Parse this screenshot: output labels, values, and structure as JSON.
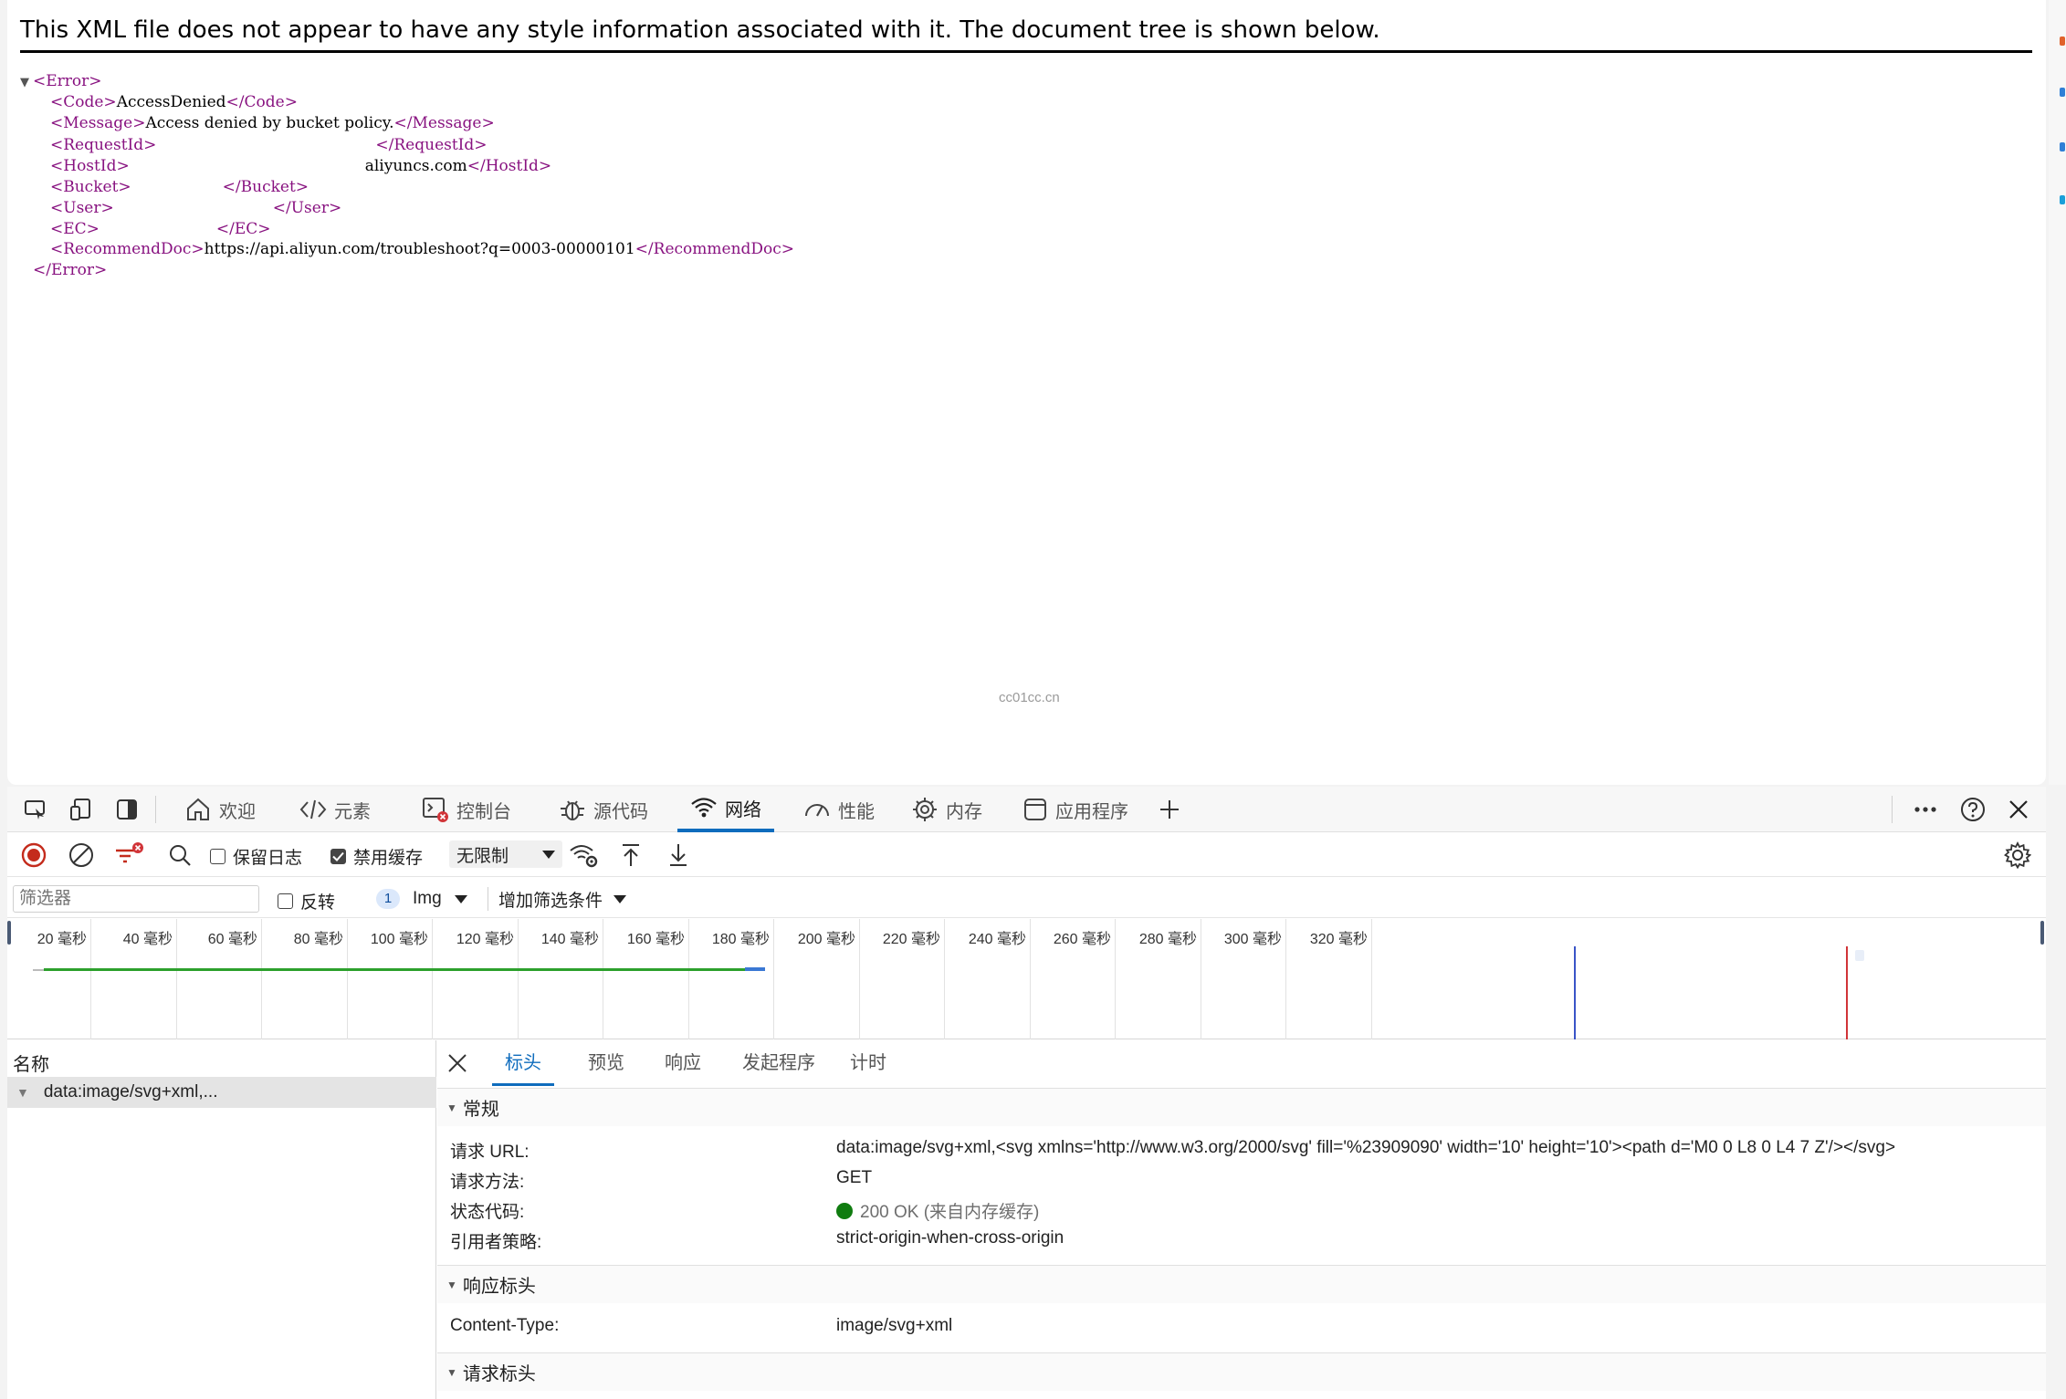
{
  "xml_viewer": {
    "banner": "This XML file does not appear to have any style information associated with it. The document tree is shown below.",
    "tree": {
      "root_open": "<Error>",
      "root_close": "</Error>",
      "code_open": "<Code>",
      "code_value": "AccessDenied",
      "code_close": "</Code>",
      "message_open": "<Message>",
      "message_value": "Access denied by bucket policy.",
      "message_close": "</Message>",
      "requestid_open": "<RequestId>",
      "requestid_close": "</RequestId>",
      "hostid_open": "<HostId>",
      "hostid_suffix": "aliyuncs.com",
      "hostid_close": "</HostId>",
      "bucket_open": "<Bucket>",
      "bucket_close": "</Bucket>",
      "user_open": "<User>",
      "user_close": "</User>",
      "ec_open": "<EC>",
      "ec_close": "</EC>",
      "recdoc_open": "<RecommendDoc>",
      "recdoc_value": "https://api.aliyun.com/troubleshoot?q=0003-00000101",
      "recdoc_close": "</RecommendDoc>"
    },
    "watermark": "cc01cc.cn"
  },
  "devtools": {
    "tabs": [
      {
        "label": "欢迎",
        "icon": "home-icon"
      },
      {
        "label": "元素",
        "icon": "code-icon"
      },
      {
        "label": "控制台",
        "icon": "console-icon"
      },
      {
        "label": "源代码",
        "icon": "bug-icon"
      },
      {
        "label": "网络",
        "icon": "wifi-icon",
        "active": true
      },
      {
        "label": "性能",
        "icon": "gauge-icon"
      },
      {
        "label": "内存",
        "icon": "chip-icon"
      },
      {
        "label": "应用程序",
        "icon": "app-icon"
      }
    ],
    "network_toolbar": {
      "preserve_log": "保留日志",
      "preserve_log_checked": false,
      "disable_cache": "禁用缓存",
      "disable_cache_checked": true,
      "throttle": "无限制"
    },
    "filter_bar": {
      "placeholder": "筛选器",
      "invert": "反转",
      "type_count": "1",
      "type": "Img",
      "add_filter": "增加筛选条件"
    },
    "timeline": {
      "unit": "毫秒",
      "ticks": [
        "20",
        "40",
        "60",
        "80",
        "100",
        "120",
        "140",
        "160",
        "180",
        "200",
        "220",
        "240",
        "260",
        "280",
        "300",
        "320"
      ]
    },
    "requests": {
      "column_name": "名称",
      "items": [
        "data:image/svg+xml,..."
      ]
    },
    "details": {
      "tabs": [
        "标头",
        "预览",
        "响应",
        "发起程序",
        "计时"
      ],
      "general_header": "常规",
      "general": [
        {
          "key": "请求 URL:",
          "value": "data:image/svg+xml,<svg xmlns='http://www.w3.org/2000/svg' fill='%23909090' width='10' height='10'><path d='M0 0 L8 0 L4 7 Z'/></svg>"
        },
        {
          "key": "请求方法:",
          "value": "GET"
        },
        {
          "key": "状态代码:",
          "value": "200 OK (来自内存缓存)"
        },
        {
          "key": "引用者策略:",
          "value": "strict-origin-when-cross-origin"
        }
      ],
      "response_header": "响应标头",
      "response": [
        {
          "key": "Content-Type:",
          "value": "image/svg+xml"
        }
      ],
      "request_header": "请求标头"
    },
    "colors": {
      "accent": "#0f6cbd",
      "record_red": "#c42b1c",
      "status_green": "#107c10",
      "xml_tag": "#881280"
    }
  }
}
